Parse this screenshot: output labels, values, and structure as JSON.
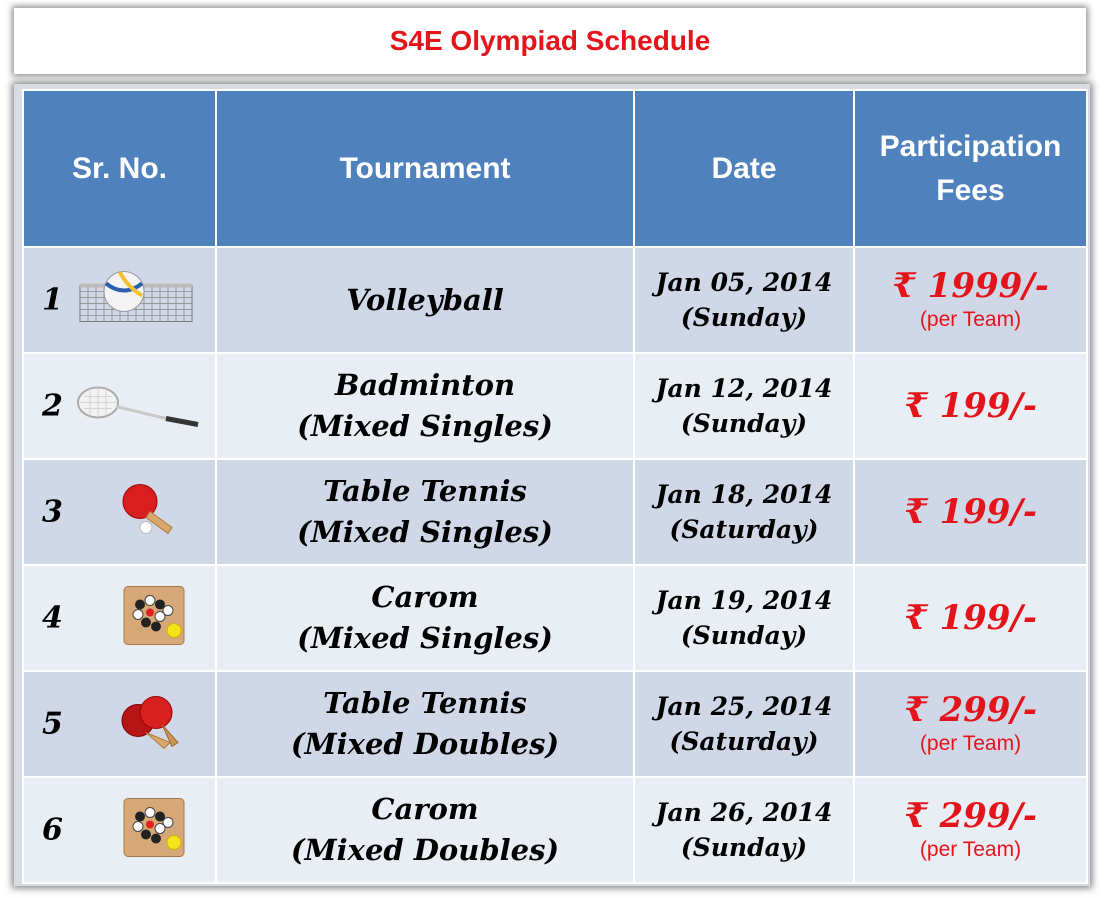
{
  "title": "S4E Olympiad Schedule",
  "headers": {
    "sr": "Sr. No.",
    "tournament": "Tournament",
    "date": "Date",
    "fees_line1": "Participation",
    "fees_line2": "Fees"
  },
  "rows": [
    {
      "sr": "1",
      "icon": "volleyball-net-icon",
      "tournament_line1": "Volleyball",
      "tournament_line2": "",
      "date_line1": "Jan 05, 2014",
      "date_line2": "(Sunday)",
      "fee": "₹ 1999/-",
      "fee_note": "(per Team)"
    },
    {
      "sr": "2",
      "icon": "badminton-racket-icon",
      "tournament_line1": "Badminton",
      "tournament_line2": "(Mixed Singles)",
      "date_line1": "Jan 12, 2014",
      "date_line2": "(Sunday)",
      "fee": "₹ 199/-",
      "fee_note": ""
    },
    {
      "sr": "3",
      "icon": "table-tennis-paddle-icon",
      "tournament_line1": "Table Tennis",
      "tournament_line2": "(Mixed Singles)",
      "date_line1": "Jan 18, 2014",
      "date_line2": "(Saturday)",
      "fee": "₹ 199/-",
      "fee_note": ""
    },
    {
      "sr": "4",
      "icon": "carom-board-icon",
      "tournament_line1": "Carom",
      "tournament_line2": "(Mixed Singles)",
      "date_line1": "Jan 19, 2014",
      "date_line2": "(Sunday)",
      "fee": "₹ 199/-",
      "fee_note": ""
    },
    {
      "sr": "5",
      "icon": "table-tennis-paddles-icon",
      "tournament_line1": "Table Tennis",
      "tournament_line2": "(Mixed Doubles)",
      "date_line1": "Jan 25, 2014",
      "date_line2": "(Saturday)",
      "fee": "₹ 299/-",
      "fee_note": "(per Team)"
    },
    {
      "sr": "6",
      "icon": "carom-board-icon",
      "tournament_line1": "Carom",
      "tournament_line2": "(Mixed Doubles)",
      "date_line1": "Jan 26, 2014",
      "date_line2": "(Sunday)",
      "fee": "₹ 299/-",
      "fee_note": "(per Team)"
    }
  ],
  "colors": {
    "title_red": "#e4141b",
    "header_blue": "#4f81bd",
    "row_dark": "#d0d8e8",
    "row_light": "#e9edf4"
  }
}
